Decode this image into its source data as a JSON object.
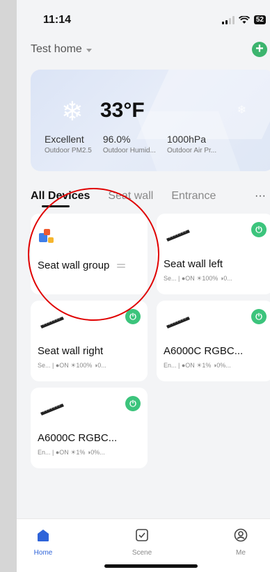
{
  "status": {
    "time": "11:14",
    "battery": "52"
  },
  "header": {
    "home_name": "Test home",
    "add_icon": "plus-circle-icon"
  },
  "weather": {
    "temperature": "33°F",
    "stats": [
      {
        "value": "Excellent",
        "label": "Outdoor PM2.5"
      },
      {
        "value": "96.0%",
        "label": "Outdoor Humid..."
      },
      {
        "value": "1000hPa",
        "label": "Outdoor Air Pr..."
      }
    ]
  },
  "tabs": {
    "items": [
      "All Devices",
      "Seat wall",
      "Entrance"
    ],
    "more": "···"
  },
  "devices": [
    {
      "name": "Seat wall group",
      "sub": ""
    },
    {
      "name": "Seat wall left",
      "sub": "Se... | ●ON ☀100% ◑0..."
    },
    {
      "name": "Seat wall right",
      "sub": "Se... | ●ON ☀100% ◑0..."
    },
    {
      "name": "A6000C RGBC...",
      "sub": "En... | ●ON ☀1% ◑0%..."
    },
    {
      "name": "A6000C RGBC...",
      "sub": "En... | ●ON ☀1% ◑0%..."
    }
  ],
  "bottom_nav": [
    {
      "label": "Home",
      "icon": "home-icon"
    },
    {
      "label": "Scene",
      "icon": "checkbox-icon"
    },
    {
      "label": "Me",
      "icon": "user-circle-icon"
    }
  ],
  "colors": {
    "accent": "#3cc47c",
    "nav_active": "#2f64d9",
    "annotation": "#e00000"
  }
}
